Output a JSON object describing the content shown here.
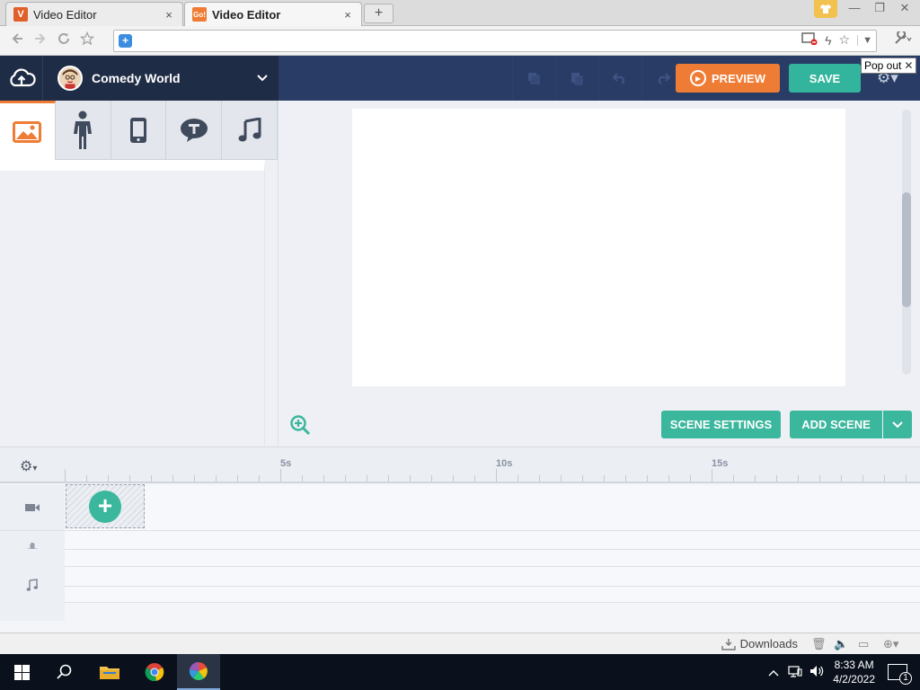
{
  "browser": {
    "tabs": [
      {
        "title": "Video Editor",
        "favicon": "V",
        "favicon_color": "#e0602a",
        "active": false
      },
      {
        "title": "Video Editor",
        "favicon": "Go!",
        "favicon_color": "#ef7c35",
        "active": true
      }
    ],
    "new_tab_label": "+",
    "close_glyph": "×",
    "popout_label": "Pop out",
    "address": ""
  },
  "app": {
    "theme_name": "Comedy World",
    "preview_label": "PREVIEW",
    "save_label": "SAVE",
    "category_tabs": [
      "backgrounds",
      "characters",
      "props",
      "text",
      "music"
    ],
    "active_category": "backgrounds",
    "scene_settings_label": "SCENE SETTINGS",
    "add_scene_label": "ADD SCENE",
    "accent_orange": "#ef7c35",
    "accent_teal": "#3bb79d",
    "header_color": "#283c66"
  },
  "timeline": {
    "ruler_labels": [
      "5s",
      "10s",
      "15s"
    ],
    "tracks": [
      "video-icon",
      "microphone-icon",
      "music-note-icon"
    ]
  },
  "statusbar": {
    "downloads_label": "Downloads"
  },
  "taskbar": {
    "time": "8:33 AM",
    "date": "4/2/2022",
    "notification_count": "1"
  }
}
